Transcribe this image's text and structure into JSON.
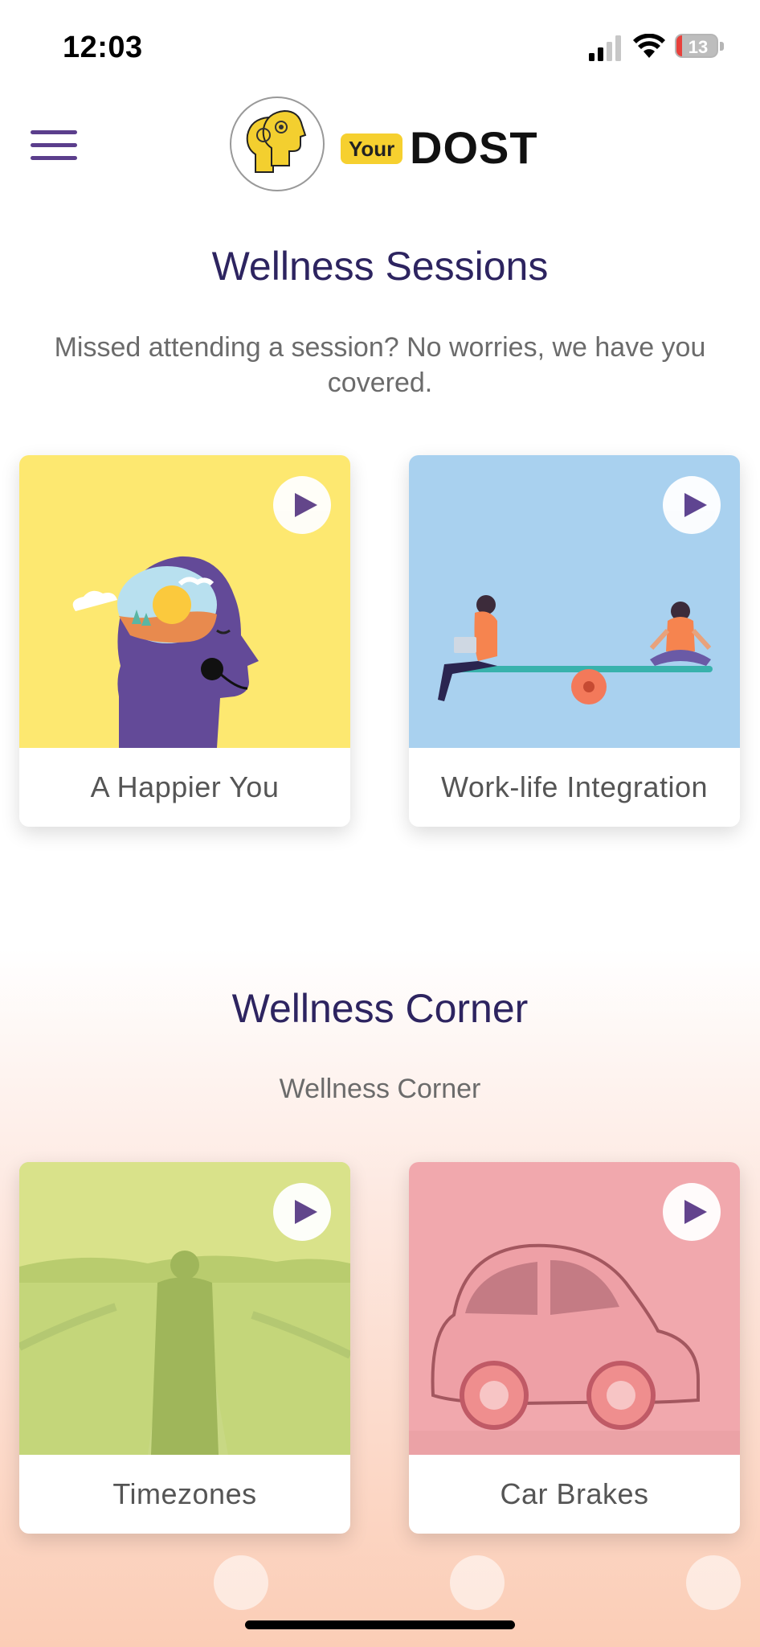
{
  "status_bar": {
    "time": "12:03",
    "battery_level": "13",
    "battery_fraction": 0.13,
    "signal_icon": "cellular-signal-icon",
    "wifi_icon": "wifi-icon",
    "battery_icon": "battery-icon"
  },
  "header": {
    "menu_icon": "hamburger-menu-icon",
    "logo_your": "Your",
    "logo_dost": "DOST"
  },
  "sessions": {
    "title": "Wellness Sessions",
    "subtitle": "Missed attending a session? No worries, we have you covered.",
    "cards": [
      {
        "label": "A Happier You",
        "bg_color": "#fde870"
      },
      {
        "label": "Work-life Integration",
        "bg_color": "#a9d1ef"
      }
    ]
  },
  "corner": {
    "title": "Wellness Corner",
    "subtitle": "Wellness Corner",
    "cards": [
      {
        "label": "Timezones",
        "bg_color": "#c4d67a"
      },
      {
        "label": "Car Brakes",
        "bg_color": "#f1a8ad"
      }
    ]
  },
  "colors": {
    "accent": "#5b3e8c",
    "title": "#2d2460",
    "logo_yellow": "#f6d02f"
  }
}
